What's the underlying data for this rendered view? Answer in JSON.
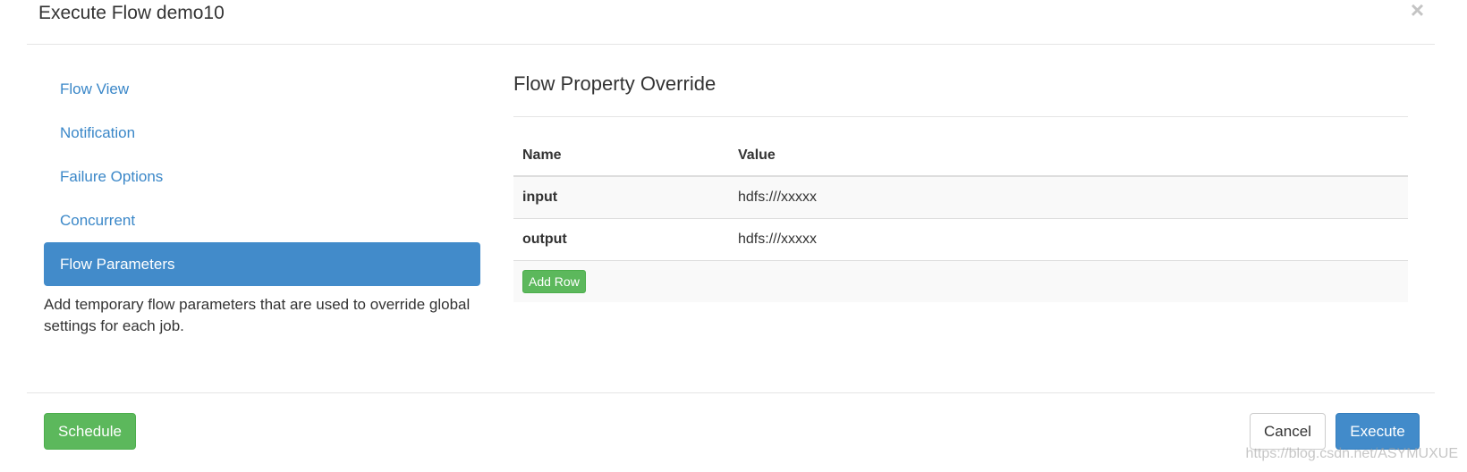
{
  "header": {
    "title": "Execute Flow demo10",
    "close_label": "×"
  },
  "nav": {
    "items": [
      {
        "label": "Flow View",
        "active": false
      },
      {
        "label": "Notification",
        "active": false
      },
      {
        "label": "Failure Options",
        "active": false
      },
      {
        "label": "Concurrent",
        "active": false
      },
      {
        "label": "Flow Parameters",
        "active": true
      }
    ],
    "help_text": "Add temporary flow parameters that are used to override global settings for each job."
  },
  "panel": {
    "title": "Flow Property Override",
    "columns": [
      "Name",
      "Value"
    ],
    "rows": [
      {
        "name": "input",
        "value": "hdfs:///xxxxx"
      },
      {
        "name": "output",
        "value": "hdfs:///xxxxx"
      }
    ],
    "add_row_label": "Add Row"
  },
  "footer": {
    "schedule_label": "Schedule",
    "cancel_label": "Cancel",
    "execute_label": "Execute"
  },
  "watermark": "https://blog.csdn.net/ASYMUXUE",
  "colors": {
    "primary": "#428bca",
    "success": "#5cb85c",
    "link": "#3a87c8"
  }
}
